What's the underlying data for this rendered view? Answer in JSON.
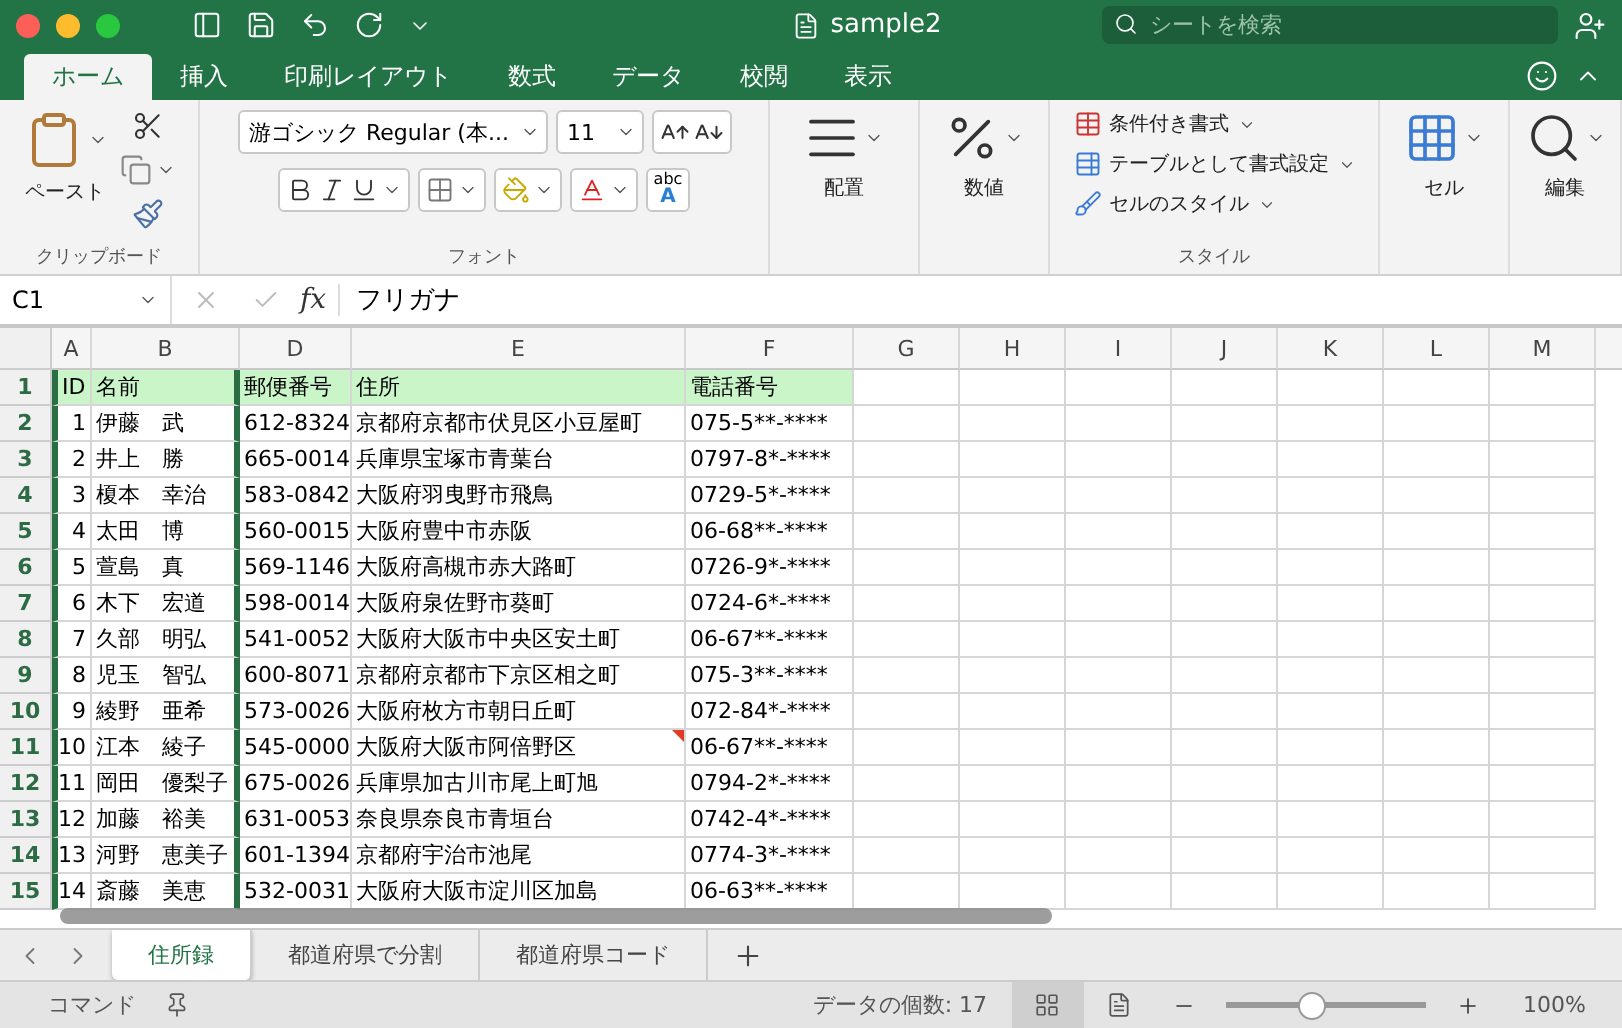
{
  "window": {
    "title": "sample2",
    "search_placeholder": "シートを検索"
  },
  "ribbon_tabs": [
    {
      "label": "ホーム",
      "selected": true
    },
    {
      "label": "挿入",
      "selected": false
    },
    {
      "label": "印刷レイアウト",
      "selected": false
    },
    {
      "label": "数式",
      "selected": false
    },
    {
      "label": "データ",
      "selected": false
    },
    {
      "label": "校閲",
      "selected": false
    },
    {
      "label": "表示",
      "selected": false
    }
  ],
  "ribbon": {
    "clipboard": {
      "paste": "ペースト",
      "group": "クリップボード"
    },
    "font": {
      "name": "游ゴシック Regular (本...",
      "size": "11",
      "phonetic_top": "abc",
      "phonetic_bottom": "A",
      "group": "フォント"
    },
    "alignment": {
      "label": "配置"
    },
    "number": {
      "label": "数値"
    },
    "styles": {
      "items": [
        "条件付き書式",
        "テーブルとして書式設定",
        "セルのスタイル"
      ],
      "group": "スタイル"
    },
    "cells": {
      "label": "セル"
    },
    "editing": {
      "label": "編集"
    }
  },
  "formula_bar": {
    "name_box": "C1",
    "fx": "fx",
    "formula": "フリガナ"
  },
  "columns": [
    "A",
    "B",
    "D",
    "E",
    "F",
    "G",
    "H",
    "I",
    "J",
    "K",
    "L",
    "M"
  ],
  "rows": [
    {
      "number": "1",
      "kind": "header",
      "comment": false,
      "cells": [
        "ID",
        "名前",
        "郵便番号",
        "住所",
        "電話番号"
      ]
    },
    {
      "number": "2",
      "kind": "data",
      "comment": false,
      "cells": [
        "1",
        "伊藤　武",
        "612-8324",
        "京都府京都市伏見区小豆屋町",
        "075-5**-****"
      ]
    },
    {
      "number": "3",
      "kind": "data",
      "comment": false,
      "cells": [
        "2",
        "井上　勝",
        "665-0014",
        "兵庫県宝塚市青葉台",
        "0797-8*-****"
      ]
    },
    {
      "number": "4",
      "kind": "data",
      "comment": false,
      "cells": [
        "3",
        "榎本　幸治",
        "583-0842",
        "大阪府羽曳野市飛鳥",
        "0729-5*-****"
      ]
    },
    {
      "number": "5",
      "kind": "data",
      "comment": false,
      "cells": [
        "4",
        "太田　博",
        "560-0015",
        "大阪府豊中市赤阪",
        "06-68**-****"
      ]
    },
    {
      "number": "6",
      "kind": "data",
      "comment": false,
      "cells": [
        "5",
        "萱島　真",
        "569-1146",
        "大阪府高槻市赤大路町",
        "0726-9*-****"
      ]
    },
    {
      "number": "7",
      "kind": "data",
      "comment": false,
      "cells": [
        "6",
        "木下　宏道",
        "598-0014",
        "大阪府泉佐野市葵町",
        "0724-6*-****"
      ]
    },
    {
      "number": "8",
      "kind": "data",
      "comment": false,
      "cells": [
        "7",
        "久部　明弘",
        "541-0052",
        "大阪府大阪市中央区安土町",
        "06-67**-****"
      ]
    },
    {
      "number": "9",
      "kind": "data",
      "comment": false,
      "cells": [
        "8",
        "児玉　智弘",
        "600-8071",
        "京都府京都市下京区相之町",
        "075-3**-****"
      ]
    },
    {
      "number": "10",
      "kind": "data",
      "comment": false,
      "cells": [
        "9",
        "綾野　亜希",
        "573-0026",
        "大阪府枚方市朝日丘町",
        "072-84*-****"
      ]
    },
    {
      "number": "11",
      "kind": "data",
      "comment": true,
      "cells": [
        "10",
        "江本　綾子",
        "545-0000",
        "大阪府大阪市阿倍野区",
        "06-67**-****"
      ]
    },
    {
      "number": "12",
      "kind": "data",
      "comment": false,
      "cells": [
        "11",
        "岡田　優梨子",
        "675-0026",
        "兵庫県加古川市尾上町旭",
        "0794-2*-****"
      ]
    },
    {
      "number": "13",
      "kind": "data",
      "comment": false,
      "cells": [
        "12",
        "加藤　裕美",
        "631-0053",
        "奈良県奈良市青垣台",
        "0742-4*-****"
      ]
    },
    {
      "number": "14",
      "kind": "data",
      "comment": false,
      "cells": [
        "13",
        "河野　恵美子",
        "601-1394",
        "京都府宇治市池尾",
        "0774-3*-****"
      ]
    },
    {
      "number": "15",
      "kind": "data",
      "comment": false,
      "cells": [
        "14",
        "斎藤　美恵",
        "532-0031",
        "大阪府大阪市淀川区加島",
        "06-63**-****"
      ]
    }
  ],
  "sheet_tabs": [
    {
      "label": "住所録",
      "selected": true
    },
    {
      "label": "都道府県で分割",
      "selected": false
    },
    {
      "label": "都道府県コード",
      "selected": false
    }
  ],
  "status_bar": {
    "mode": "コマンド",
    "summary": "データの個数: 17",
    "zoom": {
      "level": 0.43,
      "reading": "100%"
    }
  }
}
